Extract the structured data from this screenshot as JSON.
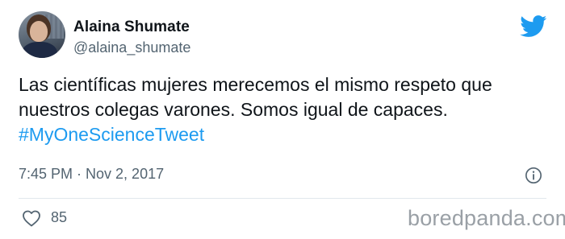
{
  "tweet": {
    "author": {
      "display_name": "Alaina Shumate",
      "handle": "@alaina_shumate"
    },
    "text_lines": [
      "Las científicas mujeres merecemos el mismo respeto que",
      "nuestros colegas varones. Somos igual de capaces."
    ],
    "hashtag": "#MyOneScienceTweet",
    "timestamp": "7:45 PM · Nov 2, 2017",
    "likes": "85"
  },
  "watermark": "boredpanda.com",
  "icons": {
    "brand": "twitter-bird-icon",
    "info": "info-icon",
    "like": "heart-icon"
  },
  "colors": {
    "brand_blue": "#1d9bf0",
    "text_primary": "#0f1419",
    "text_secondary": "#536471",
    "watermark": "#9aa0a6"
  }
}
